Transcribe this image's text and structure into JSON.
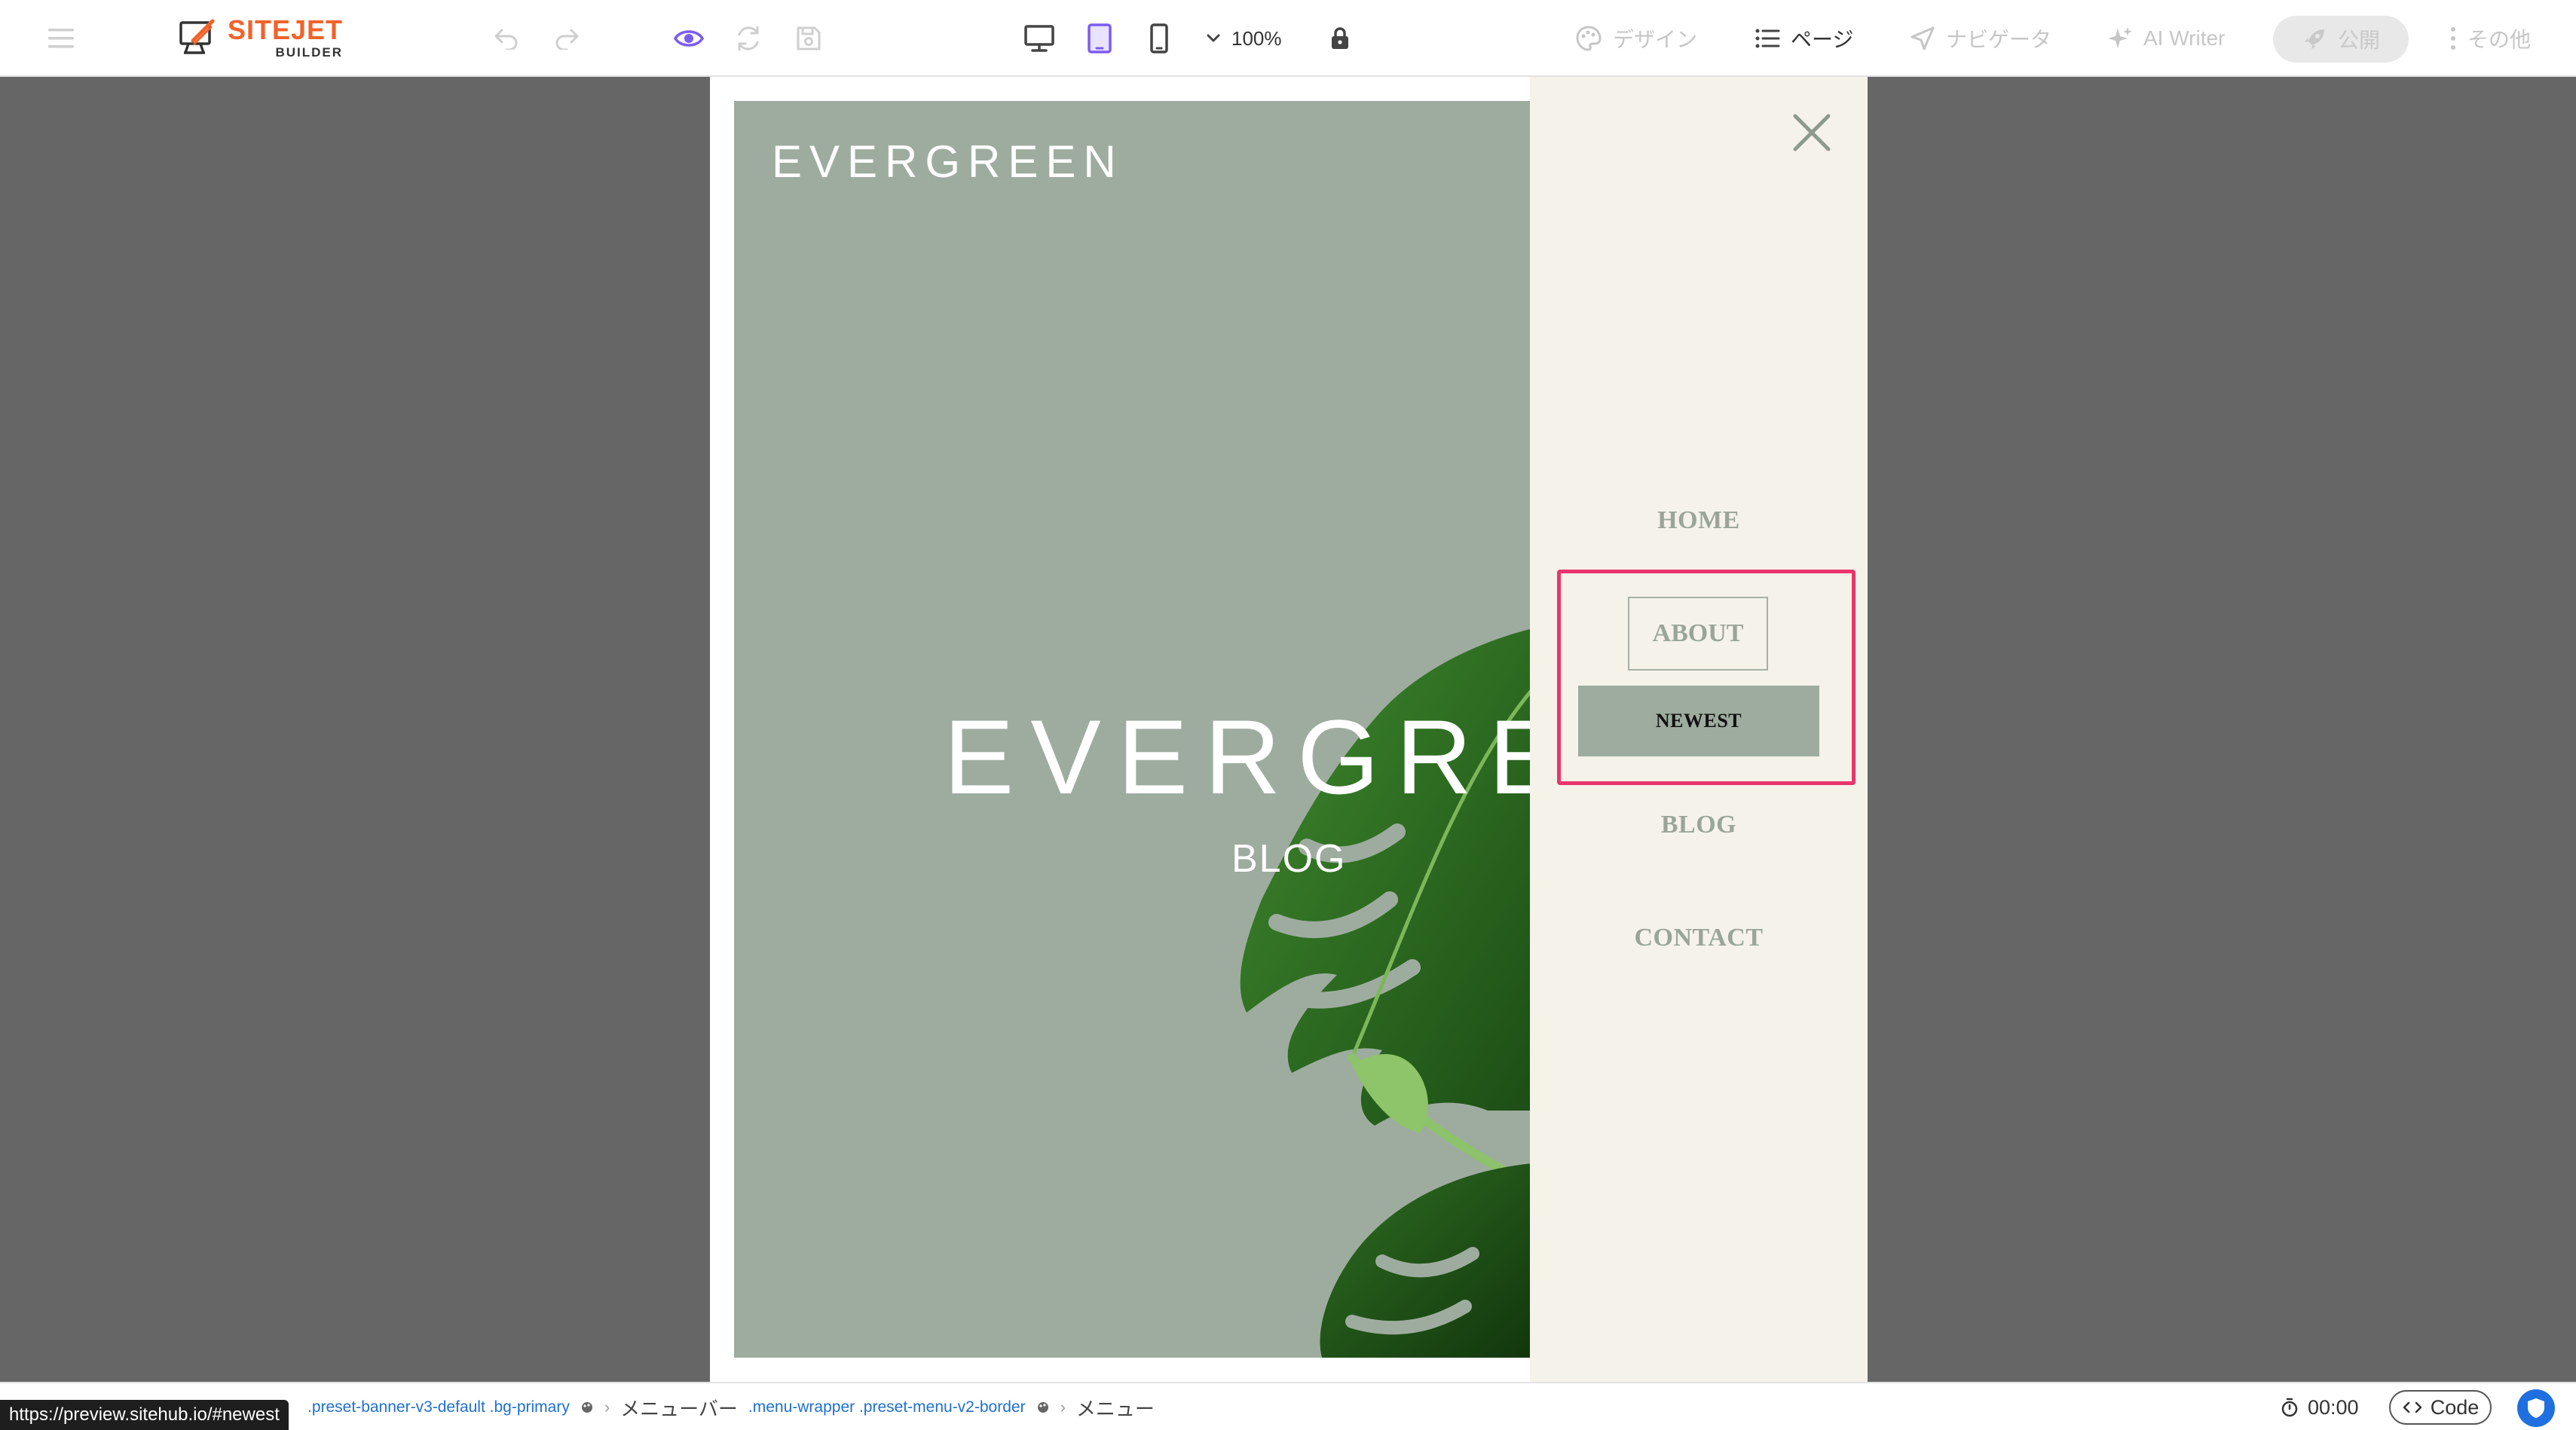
{
  "toolbar": {
    "logo_main": "SITEJET",
    "logo_sub": "BUILDER",
    "zoom_value": "100%",
    "design_label": "デザイン",
    "pages_label": "ページ",
    "navigator_label": "ナビゲータ",
    "ai_writer_label": "AI Writer",
    "publish_label": "公開",
    "more_label": "その他",
    "icons": [
      "hamburger-icon",
      "undo-icon",
      "redo-icon",
      "eye-icon",
      "refresh-icon",
      "save-icon",
      "desktop-icon",
      "tablet-icon",
      "mobile-icon",
      "chevron-down-icon",
      "lock-icon",
      "palette-icon",
      "list-icon",
      "navigation-icon",
      "sparkle-icon",
      "rocket-icon",
      "more-vertical-icon"
    ],
    "active_color": "#7b5cf0",
    "accent_color": "#f0632b"
  },
  "preview": {
    "brand": "EVERGREEN",
    "hero_title": "EVERGREEN",
    "hero_subtitle": "BLOG",
    "hero_bg": "#9eac9f",
    "menu_bg": "#f5f2e9",
    "menu": {
      "items": [
        "HOME",
        "ABOUT",
        "NEWEST",
        "BLOG",
        "CONTACT"
      ],
      "selection_color": "#e9356c"
    }
  },
  "status": {
    "url": "https://preview.sitehub.io/#newest",
    "breadcrumb": {
      "first_classes": ".preset-banner-v3-default .bg-primary",
      "menubar_label": "メニューバー",
      "menubar_classes": ".menu-wrapper .preset-menu-v2-border",
      "menu_label": "メニュー"
    },
    "timer": "00:00",
    "code_label": "Code"
  }
}
